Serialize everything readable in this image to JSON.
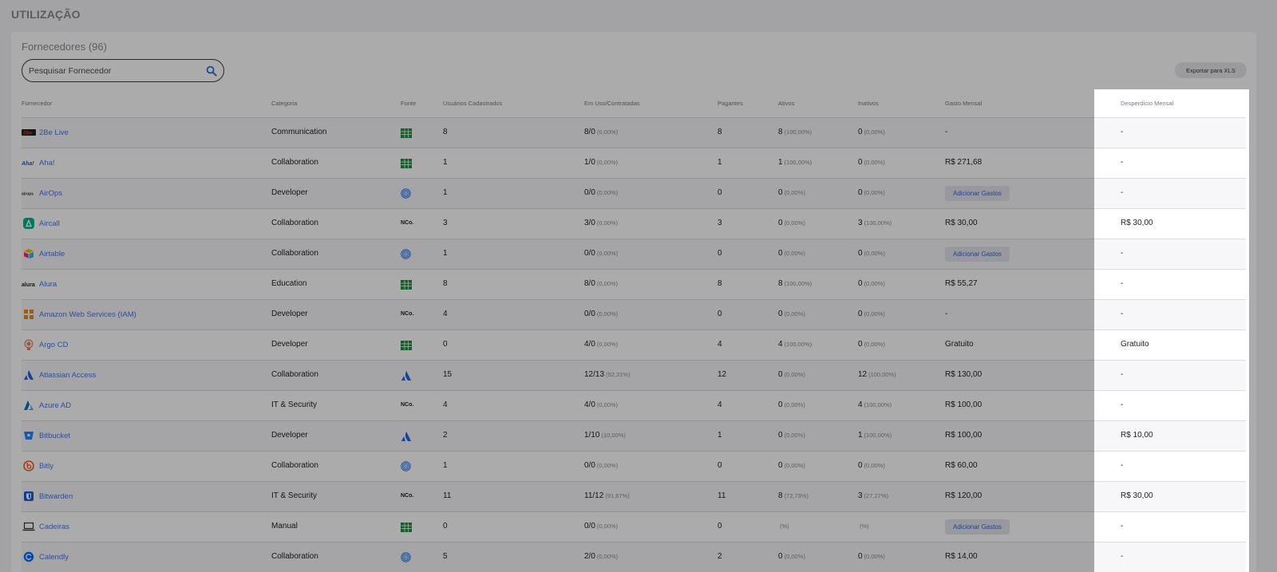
{
  "page": {
    "title": "UTILIZAÇÃO"
  },
  "vendors_card": {
    "title": "Fornecedores (96)",
    "search_placeholder": "Pesquisar Fornecedor",
    "export_label": "Exportar para XLS"
  },
  "table": {
    "headers": {
      "vendor": "Fornecedor",
      "category": "Categoria",
      "source": "Fonte",
      "registered": "Usuários Cadastrados",
      "in_use": "Em Uso/Contratadas",
      "payers": "Pagantes",
      "active": "Ativos",
      "inactive": "Inativos",
      "monthly_spend": "Gasto Mensal",
      "monthly_waste": "Desperdício Mensal"
    },
    "add_spend_label": "Adicionar Gastos",
    "rows": [
      {
        "logo": "2be-logo",
        "logo_color": "#c0392b",
        "name": "2Be Live",
        "category": "Communication",
        "source": "spreadsheet-icon",
        "registered": "8",
        "in_use": "8/0",
        "in_use_pct": "(0,00%)",
        "payers": "8",
        "active": "8",
        "active_pct": "(100,00%)",
        "inactive": "0",
        "inactive_pct": "(0,00%)",
        "spend": "-",
        "spend_button": false,
        "waste": "-"
      },
      {
        "logo": "aha-logo",
        "logo_color": "#1e5fbf",
        "name": "Aha!",
        "category": "Collaboration",
        "source": "spreadsheet-icon",
        "registered": "1",
        "in_use": "1/0",
        "in_use_pct": "(0,00%)",
        "payers": "1",
        "active": "1",
        "active_pct": "(100,00%)",
        "inactive": "0",
        "inactive_pct": "(0,00%)",
        "spend": "R$ 271,68",
        "spend_button": false,
        "waste": "-"
      },
      {
        "logo": "airops-logo",
        "logo_color": "#333333",
        "name": "AirOps",
        "category": "Developer",
        "source": "fingerprint-icon",
        "registered": "1",
        "in_use": "0/0",
        "in_use_pct": "(0,00%)",
        "payers": "0",
        "active": "0",
        "active_pct": "(0,00%)",
        "inactive": "0",
        "inactive_pct": "(0,00%)",
        "spend": "",
        "spend_button": true,
        "waste": "-"
      },
      {
        "logo": "aircall-logo",
        "logo_color": "#00b388",
        "name": "Aircall",
        "category": "Collaboration",
        "source": "nco-icon",
        "registered": "3",
        "in_use": "3/0",
        "in_use_pct": "(0,00%)",
        "payers": "3",
        "active": "0",
        "active_pct": "(0,00%)",
        "inactive": "3",
        "inactive_pct": "(100,00%)",
        "spend": "R$ 30,00",
        "spend_button": false,
        "waste": "R$ 30,00"
      },
      {
        "logo": "airtable-logo",
        "logo_color": "#f82b60",
        "name": "Airtable",
        "category": "Collaboration",
        "source": "fingerprint-icon",
        "registered": "1",
        "in_use": "0/0",
        "in_use_pct": "(0,00%)",
        "payers": "0",
        "active": "0",
        "active_pct": "(0,00%)",
        "inactive": "0",
        "inactive_pct": "(0,00%)",
        "spend": "",
        "spend_button": true,
        "waste": "-"
      },
      {
        "logo": "alura-logo",
        "logo_color": "#222222",
        "name": "Alura",
        "category": "Education",
        "source": "spreadsheet-icon",
        "registered": "8",
        "in_use": "8/0",
        "in_use_pct": "(0,00%)",
        "payers": "8",
        "active": "8",
        "active_pct": "(100,00%)",
        "inactive": "0",
        "inactive_pct": "(0,00%)",
        "spend": "R$ 55,27",
        "spend_button": false,
        "waste": "-"
      },
      {
        "logo": "aws-logo",
        "logo_color": "#e78a1e",
        "name": "Amazon Web Services (IAM)",
        "category": "Developer",
        "source": "nco-icon",
        "registered": "4",
        "in_use": "0/0",
        "in_use_pct": "(0,00%)",
        "payers": "0",
        "active": "0",
        "active_pct": "(0,00%)",
        "inactive": "0",
        "inactive_pct": "(0,00%)",
        "spend": "-",
        "spend_button": false,
        "waste": "-"
      },
      {
        "logo": "argo-logo",
        "logo_color": "#ef7b4d",
        "name": "Argo CD",
        "category": "Developer",
        "source": "spreadsheet-icon",
        "registered": "0",
        "in_use": "4/0",
        "in_use_pct": "(0,00%)",
        "payers": "4",
        "active": "4",
        "active_pct": "(100,00%)",
        "inactive": "0",
        "inactive_pct": "(0,00%)",
        "spend": "Gratuito",
        "spend_button": false,
        "waste": "Gratuito"
      },
      {
        "logo": "atlassian-logo",
        "logo_color": "#2266e3",
        "name": "Atlassian Access",
        "category": "Collaboration",
        "source": "atlassian-icon",
        "registered": "15",
        "in_use": "12/13",
        "in_use_pct": "(92,31%)",
        "payers": "12",
        "active": "0",
        "active_pct": "(0,00%)",
        "inactive": "12",
        "inactive_pct": "(100,00%)",
        "spend": "R$ 130,00",
        "spend_button": false,
        "waste": "-"
      },
      {
        "logo": "azure-logo",
        "logo_color": "#0a6ed1",
        "name": "Azure AD",
        "category": "IT & Security",
        "source": "nco-icon",
        "registered": "4",
        "in_use": "4/0",
        "in_use_pct": "(0,00%)",
        "payers": "4",
        "active": "0",
        "active_pct": "(0,00%)",
        "inactive": "4",
        "inactive_pct": "(100,00%)",
        "spend": "R$ 100,00",
        "spend_button": false,
        "waste": "-"
      },
      {
        "logo": "bitbucket-logo",
        "logo_color": "#2684ff",
        "name": "Bitbucket",
        "category": "Developer",
        "source": "atlassian-icon",
        "registered": "2",
        "in_use": "1/10",
        "in_use_pct": "(10,00%)",
        "payers": "1",
        "active": "0",
        "active_pct": "(0,00%)",
        "inactive": "1",
        "inactive_pct": "(100,00%)",
        "spend": "R$ 100,00",
        "spend_button": false,
        "waste": "R$ 10,00"
      },
      {
        "logo": "bitly-logo",
        "logo_color": "#ee6123",
        "name": "Bitly",
        "category": "Collaboration",
        "source": "fingerprint-icon",
        "registered": "1",
        "in_use": "0/0",
        "in_use_pct": "(0,00%)",
        "payers": "0",
        "active": "0",
        "active_pct": "(0,00%)",
        "inactive": "0",
        "inactive_pct": "(0,00%)",
        "spend": "R$ 60,00",
        "spend_button": false,
        "waste": "-"
      },
      {
        "logo": "bitwarden-logo",
        "logo_color": "#175ddc",
        "name": "Bitwarden",
        "category": "IT & Security",
        "source": "nco-icon",
        "registered": "11",
        "in_use": "11/12",
        "in_use_pct": "(91,67%)",
        "payers": "11",
        "active": "8",
        "active_pct": "(72,73%)",
        "inactive": "3",
        "inactive_pct": "(27,27%)",
        "spend": "R$ 120,00",
        "spend_button": false,
        "waste": "R$ 30,00"
      },
      {
        "logo": "laptop-logo",
        "logo_color": "#333333",
        "name": "Cadeiras",
        "category": "Manual",
        "source": "spreadsheet-icon",
        "registered": "0",
        "in_use": "0/0",
        "in_use_pct": "(0,00%)",
        "payers": "0",
        "active": "",
        "active_pct": "(%)",
        "inactive": "",
        "inactive_pct": "(%)",
        "spend": "",
        "spend_button": true,
        "waste": "-"
      },
      {
        "logo": "calendly-logo",
        "logo_color": "#006bff",
        "name": "Calendly",
        "category": "Collaboration",
        "source": "fingerprint-icon",
        "registered": "5",
        "in_use": "2/0",
        "in_use_pct": "(0,00%)",
        "payers": "2",
        "active": "0",
        "active_pct": "(0,00%)",
        "inactive": "0",
        "inactive_pct": "(0,00%)",
        "spend": "R$ 14,00",
        "spend_button": false,
        "waste": "-"
      }
    ]
  }
}
